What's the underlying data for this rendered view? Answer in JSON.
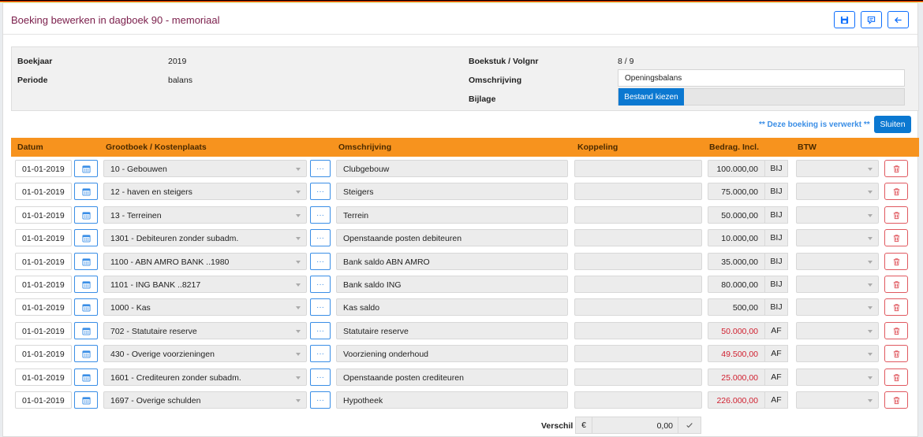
{
  "header": {
    "title": "Boeking bewerken in dagboek 90 - memoriaal"
  },
  "info": {
    "boekjaar_label": "Boekjaar",
    "boekjaar": "2019",
    "periode_label": "Periode",
    "periode": "balans",
    "boekstuk_label": "Boekstuk / Volgnr",
    "boekstuk": "8 / 9",
    "omschrijving_label": "Omschrijving",
    "omschrijving": "Openingsbalans",
    "bijlage_label": "Bijlage",
    "bijlage_button": "Bestand kiezen"
  },
  "status_note": "** Deze boeking is verwerkt **",
  "close_label": "Sluiten",
  "columns": {
    "datum": "Datum",
    "grootboek": "Grootboek / Kostenplaats",
    "omschrijving": "Omschrijving",
    "koppeling": "Koppeling",
    "bedrag": "Bedrag. Incl.",
    "btw": "BTW"
  },
  "rows": [
    {
      "date": "01-01-2019",
      "account": "10 - Gebouwen",
      "description": "Clubgebouw",
      "amount": "100.000,00",
      "type": "BIJ",
      "negative": false
    },
    {
      "date": "01-01-2019",
      "account": "12 - haven en steigers",
      "description": "Steigers",
      "amount": "75.000,00",
      "type": "BIJ",
      "negative": false
    },
    {
      "date": "01-01-2019",
      "account": "13 - Terreinen",
      "description": "Terrein",
      "amount": "50.000,00",
      "type": "BIJ",
      "negative": false
    },
    {
      "date": "01-01-2019",
      "account": "1301 - Debiteuren zonder subadm.",
      "description": "Openstaande posten debiteuren",
      "amount": "10.000,00",
      "type": "BIJ",
      "negative": false
    },
    {
      "date": "01-01-2019",
      "account": "1100 - ABN AMRO BANK ..1980",
      "description": "Bank saldo ABN AMRO",
      "amount": "35.000,00",
      "type": "BIJ",
      "negative": false
    },
    {
      "date": "01-01-2019",
      "account": "1101 - ING BANK ..8217",
      "description": "Bank saldo ING",
      "amount": "80.000,00",
      "type": "BIJ",
      "negative": false
    },
    {
      "date": "01-01-2019",
      "account": "1000 - Kas",
      "description": "Kas saldo",
      "amount": "500,00",
      "type": "BIJ",
      "negative": false
    },
    {
      "date": "01-01-2019",
      "account": "702 - Statutaire reserve",
      "description": "Statutaire reserve",
      "amount": "50.000,00",
      "type": "AF",
      "negative": true
    },
    {
      "date": "01-01-2019",
      "account": "430 - Overige voorzieningen",
      "description": "Voorziening onderhoud",
      "amount": "49.500,00",
      "type": "AF",
      "negative": true
    },
    {
      "date": "01-01-2019",
      "account": "1601 - Crediteuren zonder subadm.",
      "description": "Openstaande posten crediteuren",
      "amount": "25.000,00",
      "type": "AF",
      "negative": true
    },
    {
      "date": "01-01-2019",
      "account": "1697 - Overige schulden",
      "description": "Hypotheek",
      "amount": "226.000,00",
      "type": "AF",
      "negative": true
    }
  ],
  "footer": {
    "verschil_label": "Verschil",
    "currency": "€",
    "verschil": "0,00"
  },
  "colors": {
    "accent": "#0b78d1",
    "header_orange": "#f7931e",
    "negative": "#d01e2e",
    "title": "#7b1e4b"
  }
}
